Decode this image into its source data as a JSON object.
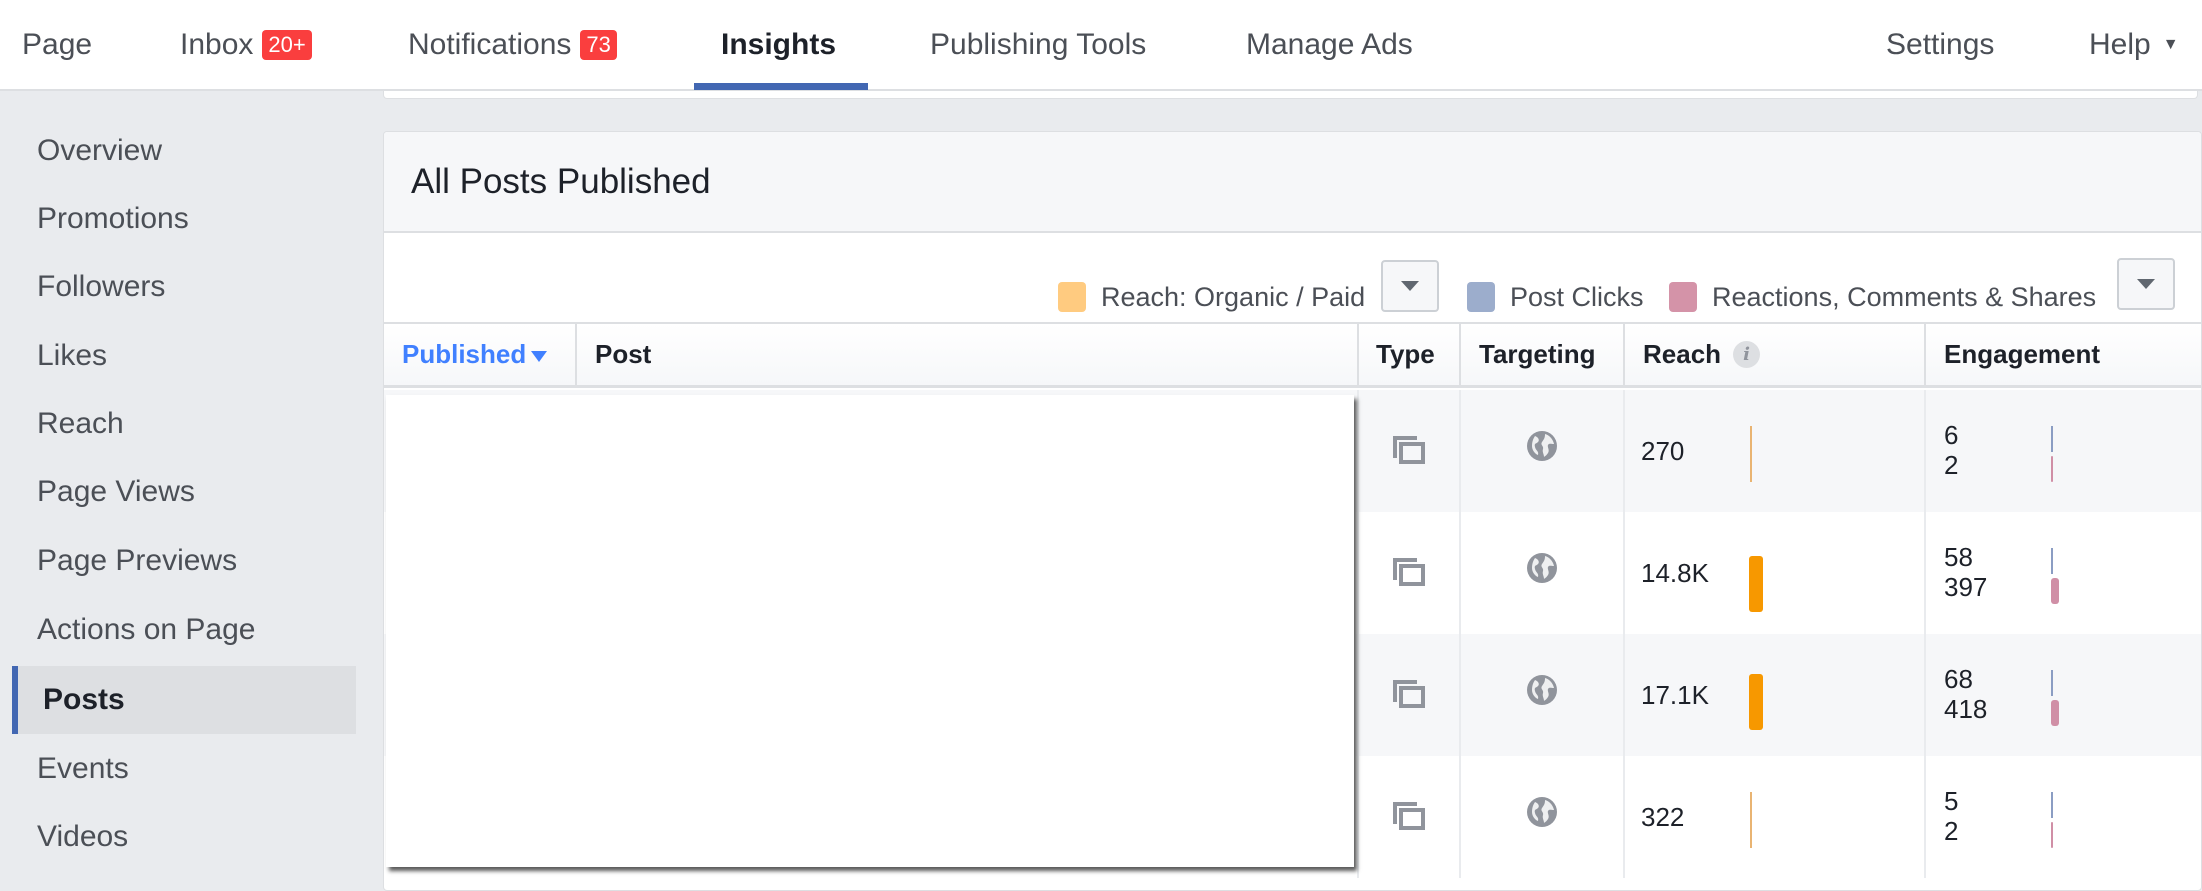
{
  "topnav": {
    "items": [
      {
        "label": "Page"
      },
      {
        "label": "Inbox",
        "badge": "20+"
      },
      {
        "label": "Notifications",
        "badge": "73"
      },
      {
        "label": "Insights",
        "active": true
      },
      {
        "label": "Publishing Tools"
      },
      {
        "label": "Manage Ads"
      },
      {
        "label": "Settings"
      },
      {
        "label": "Help",
        "caret": "▼"
      }
    ]
  },
  "sidebar": {
    "items": [
      {
        "label": "Overview"
      },
      {
        "label": "Promotions"
      },
      {
        "label": "Followers"
      },
      {
        "label": "Likes"
      },
      {
        "label": "Reach"
      },
      {
        "label": "Page Views"
      },
      {
        "label": "Page Previews"
      },
      {
        "label": "Actions on Page"
      },
      {
        "label": "Posts",
        "active": true
      },
      {
        "label": "Events"
      },
      {
        "label": "Videos"
      }
    ]
  },
  "card": {
    "title": "All Posts Published",
    "legend": [
      {
        "label": "Reach: Organic / Paid",
        "color": "#ffcb80"
      },
      {
        "label": "Post Clicks",
        "color": "#9cadcc"
      },
      {
        "label": "Reactions, Comments & Shares",
        "color": "#d493a8"
      }
    ],
    "columns": {
      "published": "Published",
      "post": "Post",
      "type": "Type",
      "targeting": "Targeting",
      "reach": "Reach",
      "reach_info": "i",
      "engagement": "Engagement"
    },
    "rows": [
      {
        "type_icon": "multi-photo-icon",
        "targeting_icon": "globe-icon",
        "reach": "270",
        "reach_value": 270,
        "post_clicks": "6",
        "reactions": "2"
      },
      {
        "type_icon": "multi-photo-icon",
        "targeting_icon": "globe-icon",
        "reach": "14.8K",
        "reach_value": 14800,
        "post_clicks": "58",
        "reactions": "397"
      },
      {
        "type_icon": "multi-photo-icon",
        "targeting_icon": "globe-icon",
        "reach": "17.1K",
        "reach_value": 17100,
        "post_clicks": "68",
        "reactions": "418"
      },
      {
        "type_icon": "multi-photo-icon",
        "targeting_icon": "globe-icon",
        "reach": "322",
        "reach_value": 322,
        "post_clicks": "5",
        "reactions": "2"
      }
    ]
  },
  "colors": {
    "accent": "#4267b2",
    "badge": "#fa3e3e",
    "sort_link": "#4080ff",
    "reach_bar": "#f79800",
    "clicks_bar": "#8b9dc3",
    "reactions_bar": "#d08fa6"
  }
}
